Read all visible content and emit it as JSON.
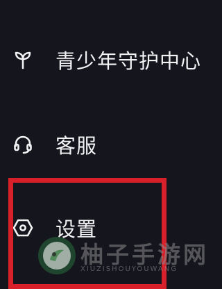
{
  "menu": {
    "items": [
      {
        "label": "青少年守护中心",
        "icon": "sprout-icon"
      },
      {
        "label": "客服",
        "icon": "headset-icon"
      },
      {
        "label": "设置",
        "icon": "gear-icon"
      }
    ]
  },
  "highlight": {
    "color": "#d8202a",
    "target": "设置"
  },
  "watermark": {
    "chinese_text": "柚子手游网",
    "pinyin_text": "XIUZISHOUYOUWANG",
    "logo": "watermark-logo"
  },
  "colors": {
    "background": "#15161d",
    "text": "#f2f2f4",
    "highlight": "#d8202a"
  }
}
